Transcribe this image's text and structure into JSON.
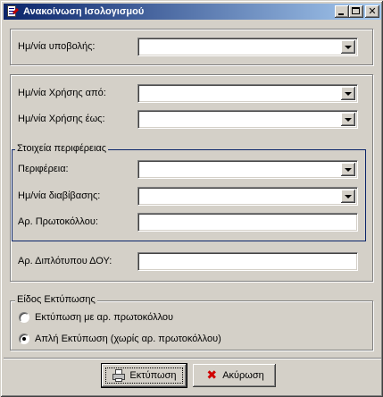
{
  "window": {
    "title": "Ανακοίνωση Ισολογισμού",
    "controls": {
      "minimize": "minimize-icon",
      "maximize": "maximize-icon",
      "close": "✕"
    }
  },
  "section_submission": {
    "date_label": "Ημ/νία υποβολής:",
    "date_value": ""
  },
  "section_period": {
    "from_label": "Ημ/νία Χρήσης από:",
    "from_value": "",
    "to_label": "Ημ/νία Χρήσης έως:",
    "to_value": "",
    "region_group": {
      "title": "Στοιχεία περιφέρειας",
      "region_label": "Περιφέρεια:",
      "region_value": "",
      "transmit_date_label": "Ημ/νία διαβίβασης:",
      "transmit_date_value": "",
      "protocol_label": "Αρ. Πρωτοκόλλου:",
      "protocol_value": ""
    },
    "duplicate_label": "Αρ. Διπλότυπου ΔΟΥ:",
    "duplicate_value": ""
  },
  "print_type": {
    "title": "Είδος Εκτύπωσης",
    "options": [
      {
        "label": "Εκτύπωση με αρ. πρωτοκόλλου",
        "selected": false
      },
      {
        "label": "Απλή Εκτύπωση (χωρίς αρ. πρωτοκόλλου)",
        "selected": true
      }
    ]
  },
  "buttons": {
    "print_label": "Εκτύπωση",
    "cancel_label": "Ακύρωση",
    "print_icon": "printer-icon",
    "cancel_icon": "cancel-x-icon"
  },
  "colors": {
    "face": "#d4d0c8",
    "title_gradient_start": "#0a246a",
    "title_gradient_end": "#a6caf0",
    "group_border": "#0a246a",
    "cancel_icon": "#d00000"
  }
}
